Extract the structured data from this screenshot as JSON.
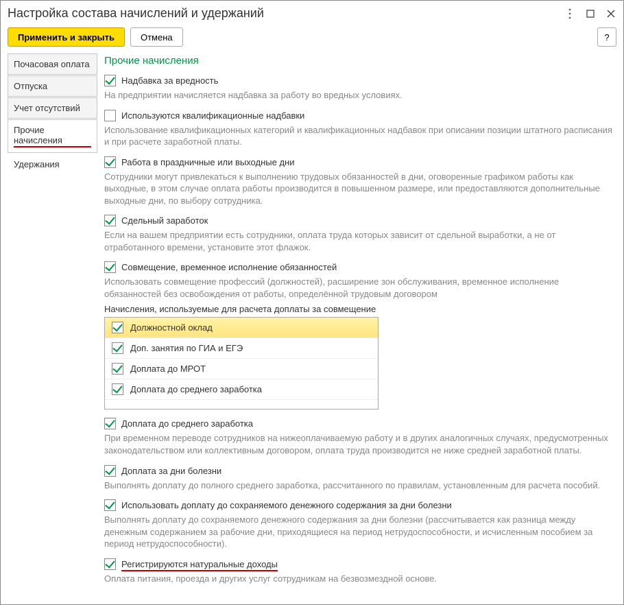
{
  "window": {
    "title": "Настройка состава начислений и удержаний"
  },
  "toolbar": {
    "apply_close": "Применить и закрыть",
    "cancel": "Отмена",
    "help": "?"
  },
  "sidebar": {
    "items": [
      {
        "label": "Почасовая оплата"
      },
      {
        "label": "Отпуска"
      },
      {
        "label": "Учет отсутствий"
      },
      {
        "label": "Прочие начисления"
      },
      {
        "label": "Удержания"
      }
    ]
  },
  "content": {
    "title": "Прочие начисления",
    "opt1": {
      "label": "Надбавка за вредность",
      "hint": "На предприятии начисляется надбавка за работу во вредных условиях."
    },
    "opt2": {
      "label": "Используются квалификационные надбавки",
      "hint": "Использование квалификационных категорий и квалификационных надбавок при описании позиции штатного расписания и при расчете заработной платы."
    },
    "opt3": {
      "label": "Работа в праздничные или выходные дни",
      "hint": "Сотрудники могут привлекаться к выполнению трудовых обязанностей в дни, оговоренные графиком работы как выходные, в этом случае оплата работы производится в повышенном размере, или предоставляются дополнительные выходные дни, по выбору сотрудника."
    },
    "opt4": {
      "label": "Сдельный заработок",
      "hint": "Если на вашем предприятии есть сотрудники, оплата труда которых зависит от сдельной выработки, а не от отработанного времени, установите этот флажок."
    },
    "opt5": {
      "label": "Совмещение, временное исполнение обязанностей",
      "hint": "Использовать совмещение профессий (должностей), расширение зон обслуживания, временное исполнение обязанностей без освобождения от работы, определённой трудовым договором"
    },
    "list_label": "Начисления, используемые для расчета доплаты за совмещение",
    "list": [
      {
        "label": "Должностной оклад"
      },
      {
        "label": "Доп. занятия по ГИА и ЕГЭ"
      },
      {
        "label": "Доплата до МРОТ"
      },
      {
        "label": "Доплата до среднего заработка"
      }
    ],
    "opt6": {
      "label": "Доплата до среднего заработка",
      "hint": "При временном переводе сотрудников на нижеоплачиваемую работу и в других аналогичных случаях, предусмотренных законодательством или коллективным договором, оплата труда производится не ниже средней заработной платы."
    },
    "opt7": {
      "label": "Доплата за дни болезни",
      "hint": "Выполнять доплату до полного среднего заработка, рассчитанного по правилам, установленным для расчета пособий."
    },
    "opt8": {
      "label": "Использовать доплату до сохраняемого денежного содержания за дни болезни",
      "hint": "Выполнять доплату до сохраняемого денежного содержания за дни болезни (рассчитывается как разница между денежным содержанием за рабочие дни, приходящиеся на период нетрудоспособности, и исчисленным пособием за период нетрудоспособности)."
    },
    "opt9": {
      "label": "Регистрируются натуральные доходы",
      "hint": "Оплата питания, проезда и других услуг сотрудникам на безвозмездной основе."
    }
  }
}
